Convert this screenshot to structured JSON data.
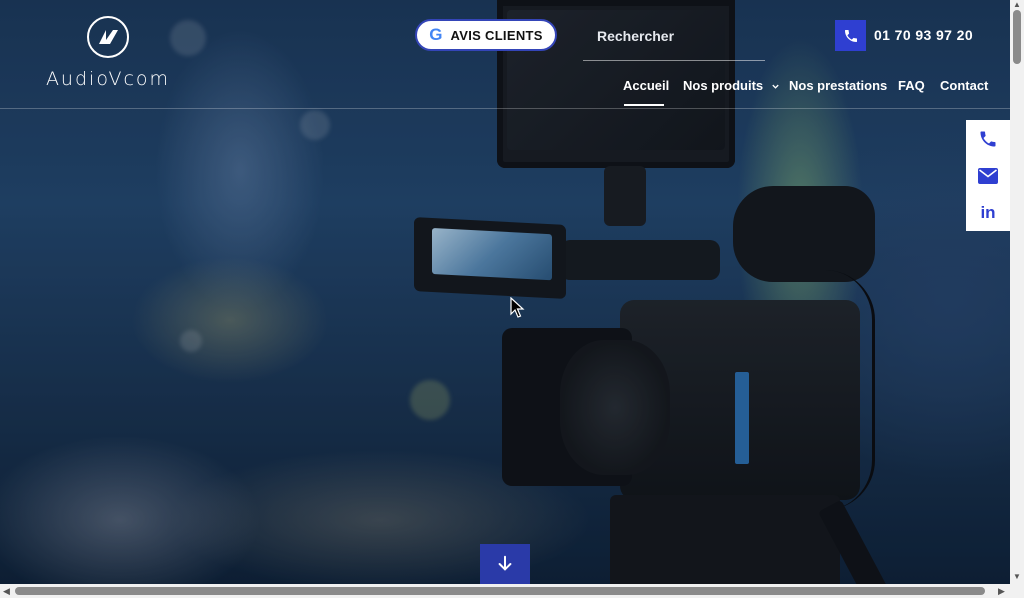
{
  "brand": {
    "name": "AudioVcom"
  },
  "header": {
    "reviews_label": "AVIS CLIENTS",
    "reviews_icon": "google-g-icon",
    "search_placeholder": "Rechercher",
    "phone_number": "01 70 93 97 20"
  },
  "nav": {
    "items": [
      {
        "label": "Accueil",
        "active": true
      },
      {
        "label": "Nos produits",
        "has_dropdown": true
      },
      {
        "label": "Nos prestations"
      },
      {
        "label": "FAQ"
      },
      {
        "label": "Contact"
      }
    ]
  },
  "side_contact": {
    "items": [
      {
        "icon": "phone-icon"
      },
      {
        "icon": "mail-icon"
      },
      {
        "icon": "linkedin-icon",
        "label": "in"
      }
    ]
  },
  "colors": {
    "accent": "#2f3fd1",
    "scroll_button": "#2a3aa8",
    "text": "#ffffff"
  }
}
